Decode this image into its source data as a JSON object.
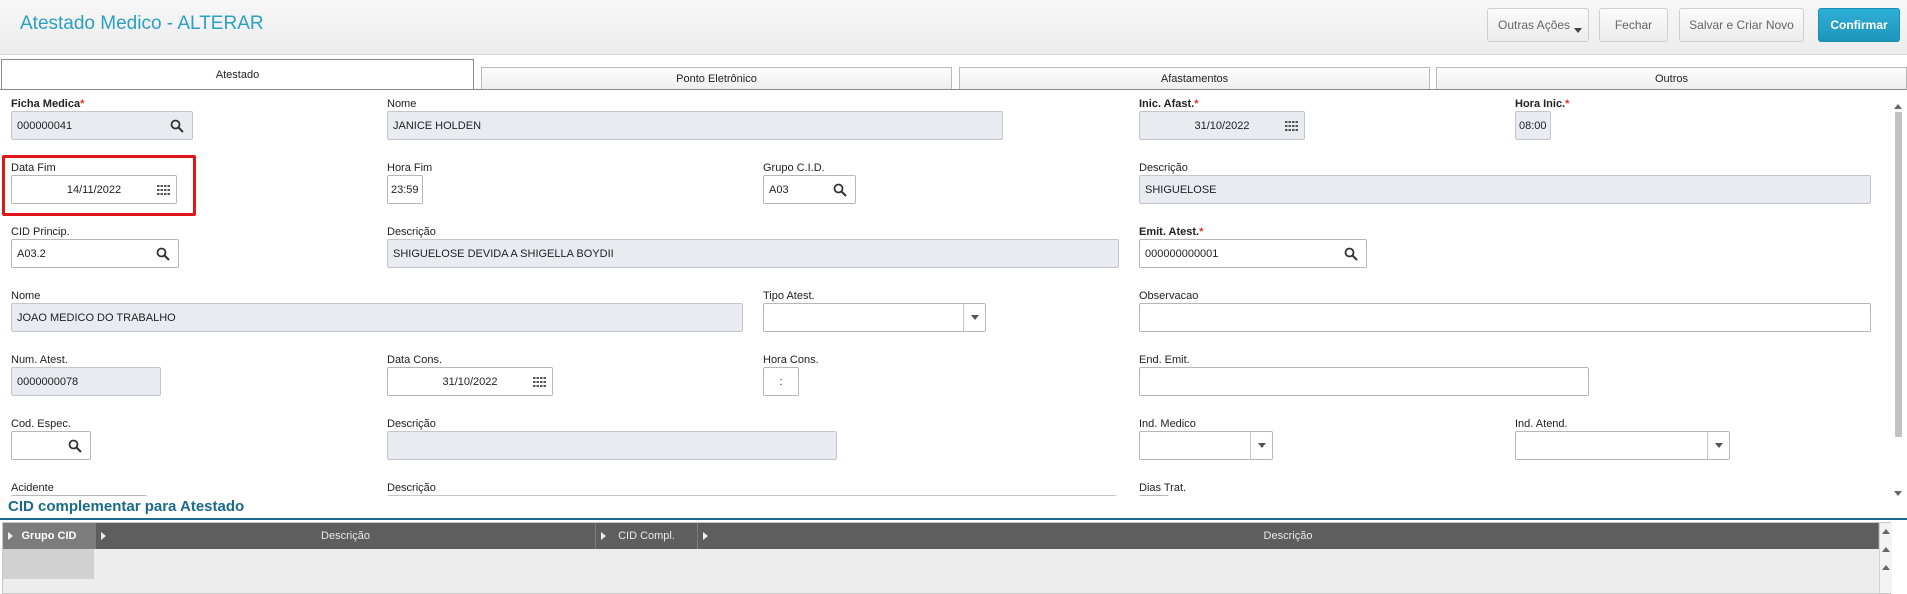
{
  "header": {
    "title": "Atestado Medico - ALTERAR",
    "buttons": {
      "outras": "Outras Ações",
      "fechar": "Fechar",
      "salvar": "Salvar e Criar Novo",
      "confirmar": "Confirmar"
    }
  },
  "tabs": [
    {
      "label": "Atestado",
      "active": true
    },
    {
      "label": "Ponto Eletrônico",
      "active": false
    },
    {
      "label": "Afastamentos",
      "active": false
    },
    {
      "label": "Outros",
      "active": false
    }
  ],
  "form": {
    "ficha_medica": {
      "label": "Ficha Medica",
      "value": "000000041"
    },
    "nome_func": {
      "label": "Nome",
      "value": "JANICE HOLDEN"
    },
    "inic_afast": {
      "label": "Inic. Afast.",
      "value": "31/10/2022"
    },
    "hora_inic": {
      "label": "Hora Inic.",
      "value": "08:00"
    },
    "data_fim": {
      "label": "Data Fim",
      "value": "14/11/2022"
    },
    "hora_fim": {
      "label": "Hora Fim",
      "value": "23:59"
    },
    "grupo_cid": {
      "label": "Grupo C.I.D.",
      "value": "A03"
    },
    "descricao_grupo": {
      "label": "Descrição",
      "value": "SHIGUELOSE"
    },
    "cid_princip": {
      "label": "CID Princip.",
      "value": "A03.2"
    },
    "descricao_cid": {
      "label": "Descrição",
      "value": "SHIGUELOSE DEVIDA A SHIGELLA BOYDII"
    },
    "emit_atest": {
      "label": "Emit. Atest.",
      "value": "000000000001"
    },
    "nome_medico": {
      "label": "Nome",
      "value": "JOAO MEDICO DO TRABALHO"
    },
    "tipo_atest": {
      "label": "Tipo Atest.",
      "value": ""
    },
    "observacao": {
      "label": "Observacao",
      "value": ""
    },
    "num_atest": {
      "label": "Num. Atest.",
      "value": "0000000078"
    },
    "data_cons": {
      "label": "Data Cons.",
      "value": "31/10/2022"
    },
    "hora_cons": {
      "label": "Hora Cons.",
      "value": ":"
    },
    "end_emit": {
      "label": "End. Emit.",
      "value": ""
    },
    "cod_espec": {
      "label": "Cod. Espec.",
      "value": ""
    },
    "descricao_espec": {
      "label": "Descrição",
      "value": ""
    },
    "ind_medico": {
      "label": "Ind. Medico",
      "value": ""
    },
    "ind_atend": {
      "label": "Ind. Atend.",
      "value": ""
    },
    "acidente": {
      "label": "Acidente"
    },
    "descricao_acid": {
      "label": "Descrição"
    },
    "dias_trat": {
      "label": "Dias Trat."
    }
  },
  "section": {
    "title": "CID complementar para Atestado"
  },
  "grid": {
    "columns": [
      "Grupo CID",
      "Descrição",
      "CID Compl.",
      "Descrição"
    ]
  },
  "colors": {
    "accent": "#2aa0c2",
    "primary_button": "#1e94bb",
    "section": "#1b6a8a",
    "required": "#dd3322",
    "highlight": "#e0161b"
  }
}
